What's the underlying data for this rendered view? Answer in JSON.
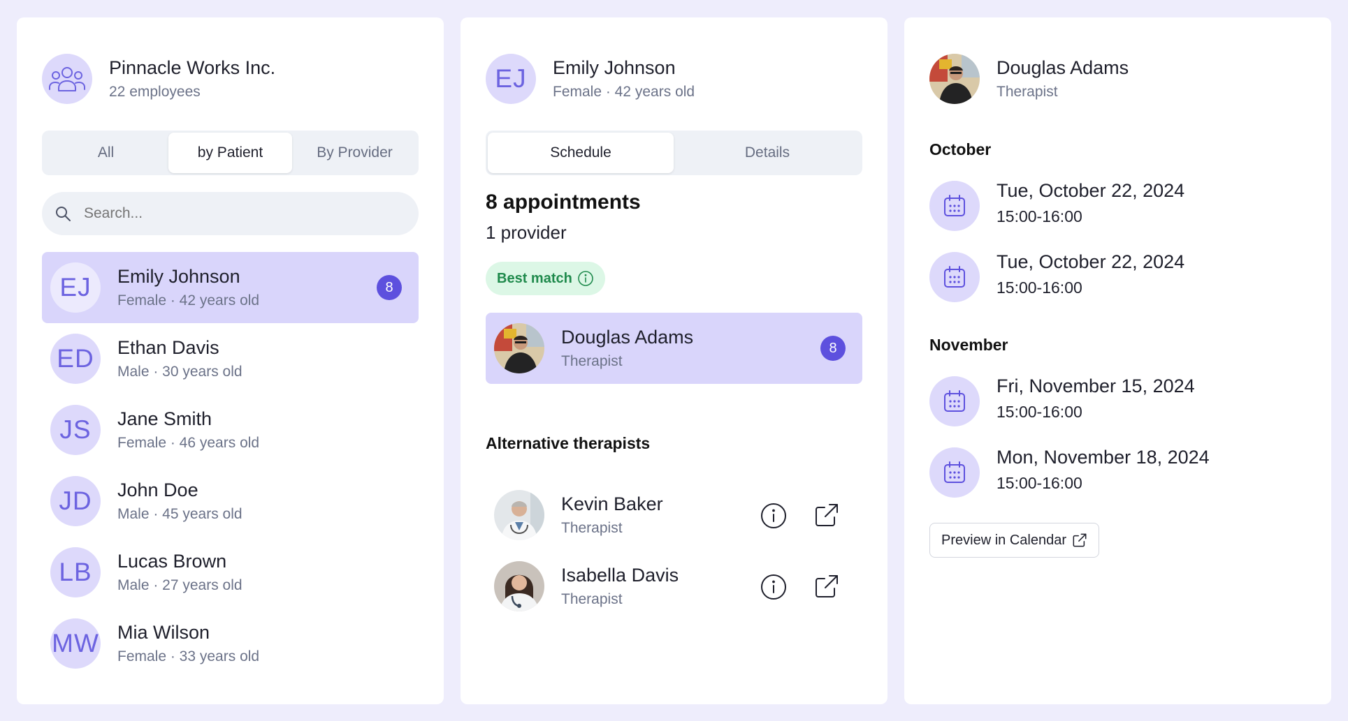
{
  "company": {
    "name": "Pinnacle Works Inc.",
    "employees": "22 employees",
    "icon": "users-group-icon"
  },
  "filter_tabs": [
    "All",
    "by Patient",
    "By Provider"
  ],
  "filter_active": 1,
  "search": {
    "placeholder": "Search...",
    "value": ""
  },
  "patients": [
    {
      "initials": "EJ",
      "name": "Emily Johnson",
      "info": "Female · 42 years old",
      "badge": "8",
      "selected": true
    },
    {
      "initials": "ED",
      "name": "Ethan Davis",
      "info": "Male · 30 years old"
    },
    {
      "initials": "JS",
      "name": "Jane Smith",
      "info": "Female · 46 years old"
    },
    {
      "initials": "JD",
      "name": "John Doe",
      "info": "Male · 45 years old"
    },
    {
      "initials": "LB",
      "name": "Lucas Brown",
      "info": "Male · 27 years old"
    },
    {
      "initials": "MW",
      "name": "Mia Wilson",
      "info": "Female · 33 years old"
    }
  ],
  "patient_detail": {
    "initials": "EJ",
    "name": "Emily Johnson",
    "info": "Female · 42 years old",
    "tabs": [
      "Schedule",
      "Details"
    ],
    "tab_active": 0,
    "appointments": "8 appointments",
    "providers": "1 provider",
    "best_match_label": "Best match",
    "best_match": {
      "name": "Douglas Adams",
      "role": "Therapist",
      "badge": "8"
    },
    "alt_heading": "Alternative therapists",
    "alternatives": [
      {
        "name": "Kevin Baker",
        "role": "Therapist"
      },
      {
        "name": "Isabella Davis",
        "role": "Therapist"
      }
    ]
  },
  "provider": {
    "name": "Douglas Adams",
    "role": "Therapist",
    "months": [
      {
        "label": "October",
        "appointments": [
          {
            "date": "Tue, October 22, 2024",
            "time": "15:00-16:00"
          },
          {
            "date": "Tue, October 22, 2024",
            "time": "15:00-16:00"
          }
        ]
      },
      {
        "label": "November",
        "appointments": [
          {
            "date": "Fri, November 15, 2024",
            "time": "15:00-16:00"
          },
          {
            "date": "Mon, November 18, 2024",
            "time": "15:00-16:00"
          }
        ]
      }
    ],
    "preview_label": "Preview in Calendar"
  },
  "colors": {
    "accent": "#5d50de",
    "avatar_bg": "#ddd9fb",
    "selected_row": "#d9d5fb",
    "page_bg": "#eeedfc",
    "success_bg": "#dcf7e6",
    "success_text": "#1f8a4c"
  }
}
